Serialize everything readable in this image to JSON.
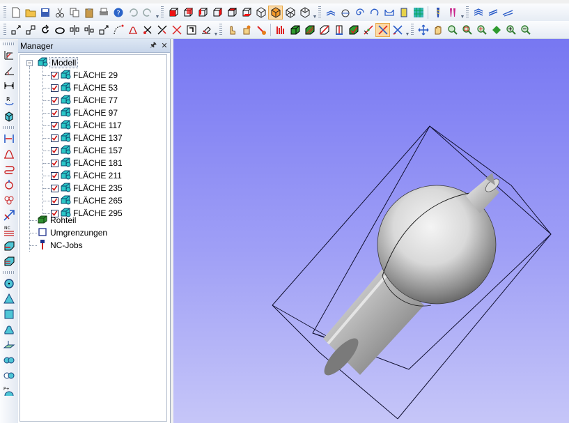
{
  "toolbar_top": {
    "icons": [
      "new-file-icon",
      "open-folder-icon",
      "save-icon",
      "cut-icon",
      "copy-icon",
      "paste-icon",
      "print-icon",
      "help-icon",
      "undo-icon",
      "redo-icon",
      "view-front-icon",
      "view-back-icon",
      "view-left-icon",
      "view-right-icon",
      "view-top-icon",
      "view-bottom-icon",
      "view-iso-icon",
      "view-iso-active-icon",
      "view-iso2-icon",
      "view-iso3-icon",
      "toolpath-2d-icon",
      "toolpath-3d-icon",
      "spiral-icon",
      "rotate-3d-icon",
      "pocket-icon",
      "stock-icon",
      "grid-icon",
      "drill-icon",
      "drill-pattern-icon",
      "layers-icon",
      "layer-stack-icon",
      "layer-plane-icon"
    ]
  },
  "toolbar_second": {
    "icons": [
      "point-icon",
      "point-grid-icon",
      "rotate-ccw-icon",
      "rotate-cw-icon",
      "mirror-h-icon",
      "mirror-v-icon",
      "scale-icon",
      "curve-icon",
      "bell-icon",
      "scissors-icon",
      "trim-icon",
      "extend-icon",
      "frame-icon",
      "erase-icon",
      "hand-pointer-icon",
      "hand-move-icon",
      "tool-icon",
      "bar-chart-icon",
      "box-green-icon",
      "box-hatched-icon",
      "box-red-slash-icon",
      "cylinder-icon",
      "box-check-icon",
      "slash-icon",
      "cross-active-icon",
      "cross-icon",
      "pan-arrows-icon",
      "hand-pan-icon",
      "zoom-icon",
      "zoom-window-icon",
      "zoom-all-icon",
      "zoom-fit-icon",
      "zoom-in-icon",
      "zoom-out-icon"
    ]
  },
  "side_toolbar": {
    "icons": [
      "dimension-icon",
      "angle-icon",
      "width-icon",
      "rotate-r-icon",
      "cube-cursor-icon",
      "align-icon",
      "bell-shape-icon",
      "loop-icon",
      "cycle-icon",
      "flower-icon",
      "star-arrow-icon",
      "nc-layers-icon",
      "cube-layer-icon",
      "cube-layer2-icon",
      "circle-icon",
      "triangle-icon",
      "square-icon",
      "blob-icon",
      "plane-icon",
      "mask-icon",
      "double-circle-icon",
      "nc-point-icon"
    ]
  },
  "manager": {
    "title": "Manager",
    "pin_icon": "pin-icon",
    "close_icon": "close-icon",
    "tree": {
      "root_label": "Modell",
      "faces": [
        "FLÄCHE 29",
        "FLÄCHE 53",
        "FLÄCHE 77",
        "FLÄCHE 97",
        "FLÄCHE 117",
        "FLÄCHE 137",
        "FLÄCHE 157",
        "FLÄCHE 181",
        "FLÄCHE 211",
        "FLÄCHE 235",
        "FLÄCHE 265",
        "FLÄCHE 295"
      ],
      "stock_label": "Rohteil",
      "boundaries_label": "Umgrenzungen",
      "jobs_label": "NC-Jobs"
    }
  },
  "colors": {
    "viewport_top": "#7777f2",
    "viewport_bottom": "#c6c6f8",
    "face_icon": "#2bc7c7",
    "check": "#d01010",
    "stock_icon": "#2f8f2f"
  }
}
